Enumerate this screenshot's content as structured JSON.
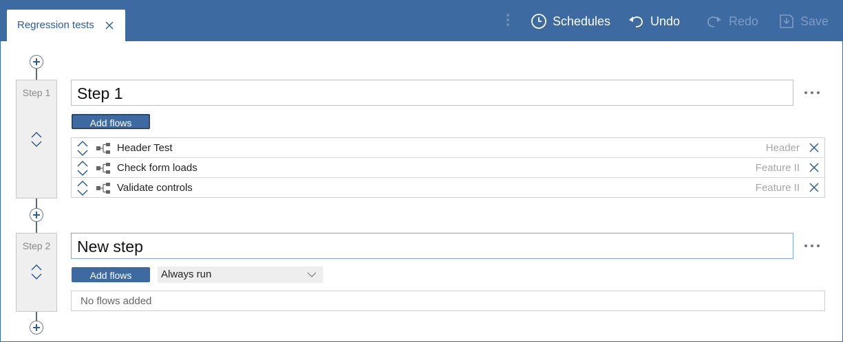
{
  "tab": {
    "title": "Regression tests",
    "close_icon": "close-icon"
  },
  "toolbar": {
    "schedules_label": "Schedules",
    "undo_label": "Undo",
    "redo_label": "Redo",
    "save_label": "Save"
  },
  "steps": [
    {
      "label": "Step 1",
      "name": "Step 1",
      "add_flows_label": "Add flows",
      "flows": [
        {
          "name": "Header Test",
          "type": "Header"
        },
        {
          "name": "Check form loads",
          "type": "Feature II"
        },
        {
          "name": "Validate controls",
          "type": "Feature II"
        }
      ]
    },
    {
      "label": "Step 2",
      "name": "New step",
      "add_flows_label": "Add flows",
      "run_condition": "Always run",
      "empty_text": "No flows added"
    }
  ],
  "colors": {
    "brand": "#3d6aa1",
    "header_bg": "#3d6aa1",
    "disabled": "#7d9cc3"
  }
}
